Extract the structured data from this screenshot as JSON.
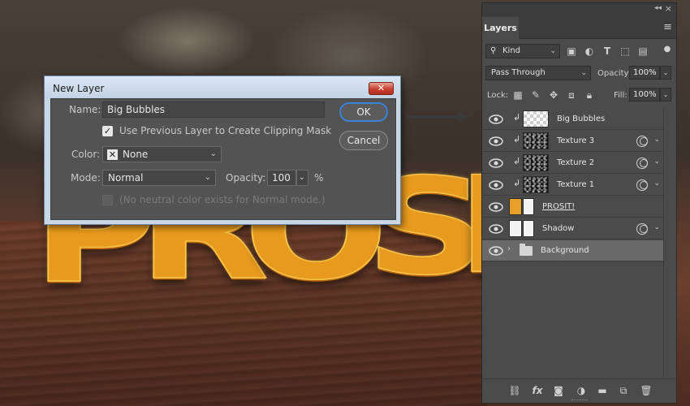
{
  "scene": {
    "letters": [
      "P",
      "R",
      "O",
      "S",
      "I"
    ]
  },
  "dialog": {
    "title": "New Layer",
    "close_label": "✕",
    "name_label": "Name:",
    "name_value": "Big Bubbles",
    "clipping_label": "Use Previous Layer to Create Clipping Mask",
    "clipping_checked": true,
    "color_label": "Color:",
    "color_value": "None",
    "mode_label": "Mode:",
    "mode_value": "Normal",
    "opacity_label": "Opacity:",
    "opacity_value": "100",
    "opacity_unit": "%",
    "neutral_label": "(No neutral color exists for Normal mode.)",
    "ok_label": "OK",
    "cancel_label": "Cancel"
  },
  "layers_panel": {
    "tab_label": "Layers",
    "filter_kind": "Kind",
    "blend_mode": "Pass Through",
    "opacity_label": "Opacity:",
    "opacity_value": "100%",
    "lock_label": "Lock:",
    "fill_label": "Fill:",
    "fill_value": "100%",
    "layers": [
      {
        "name": "Big Bubbles",
        "thumb": "checker",
        "clipped": true,
        "fx": false
      },
      {
        "name": "Texture 3",
        "thumb": "dark",
        "clipped": true,
        "fx": true
      },
      {
        "name": "Texture 2",
        "thumb": "dark",
        "clipped": true,
        "fx": true
      },
      {
        "name": "Texture 1",
        "thumb": "dark",
        "clipped": true,
        "fx": true
      },
      {
        "name": "PROSIT!",
        "thumb": "text",
        "clipped": false,
        "fx": false
      },
      {
        "name": "Shadow",
        "thumb": "shadow",
        "clipped": false,
        "fx": true
      },
      {
        "name": "Background",
        "thumb": "folder",
        "clipped": false,
        "fx": false,
        "selected": true
      }
    ]
  },
  "colors": {
    "accent": "#3a83d6",
    "panel_bg": "#4b4b4b",
    "dialog_bg": "#535353"
  }
}
